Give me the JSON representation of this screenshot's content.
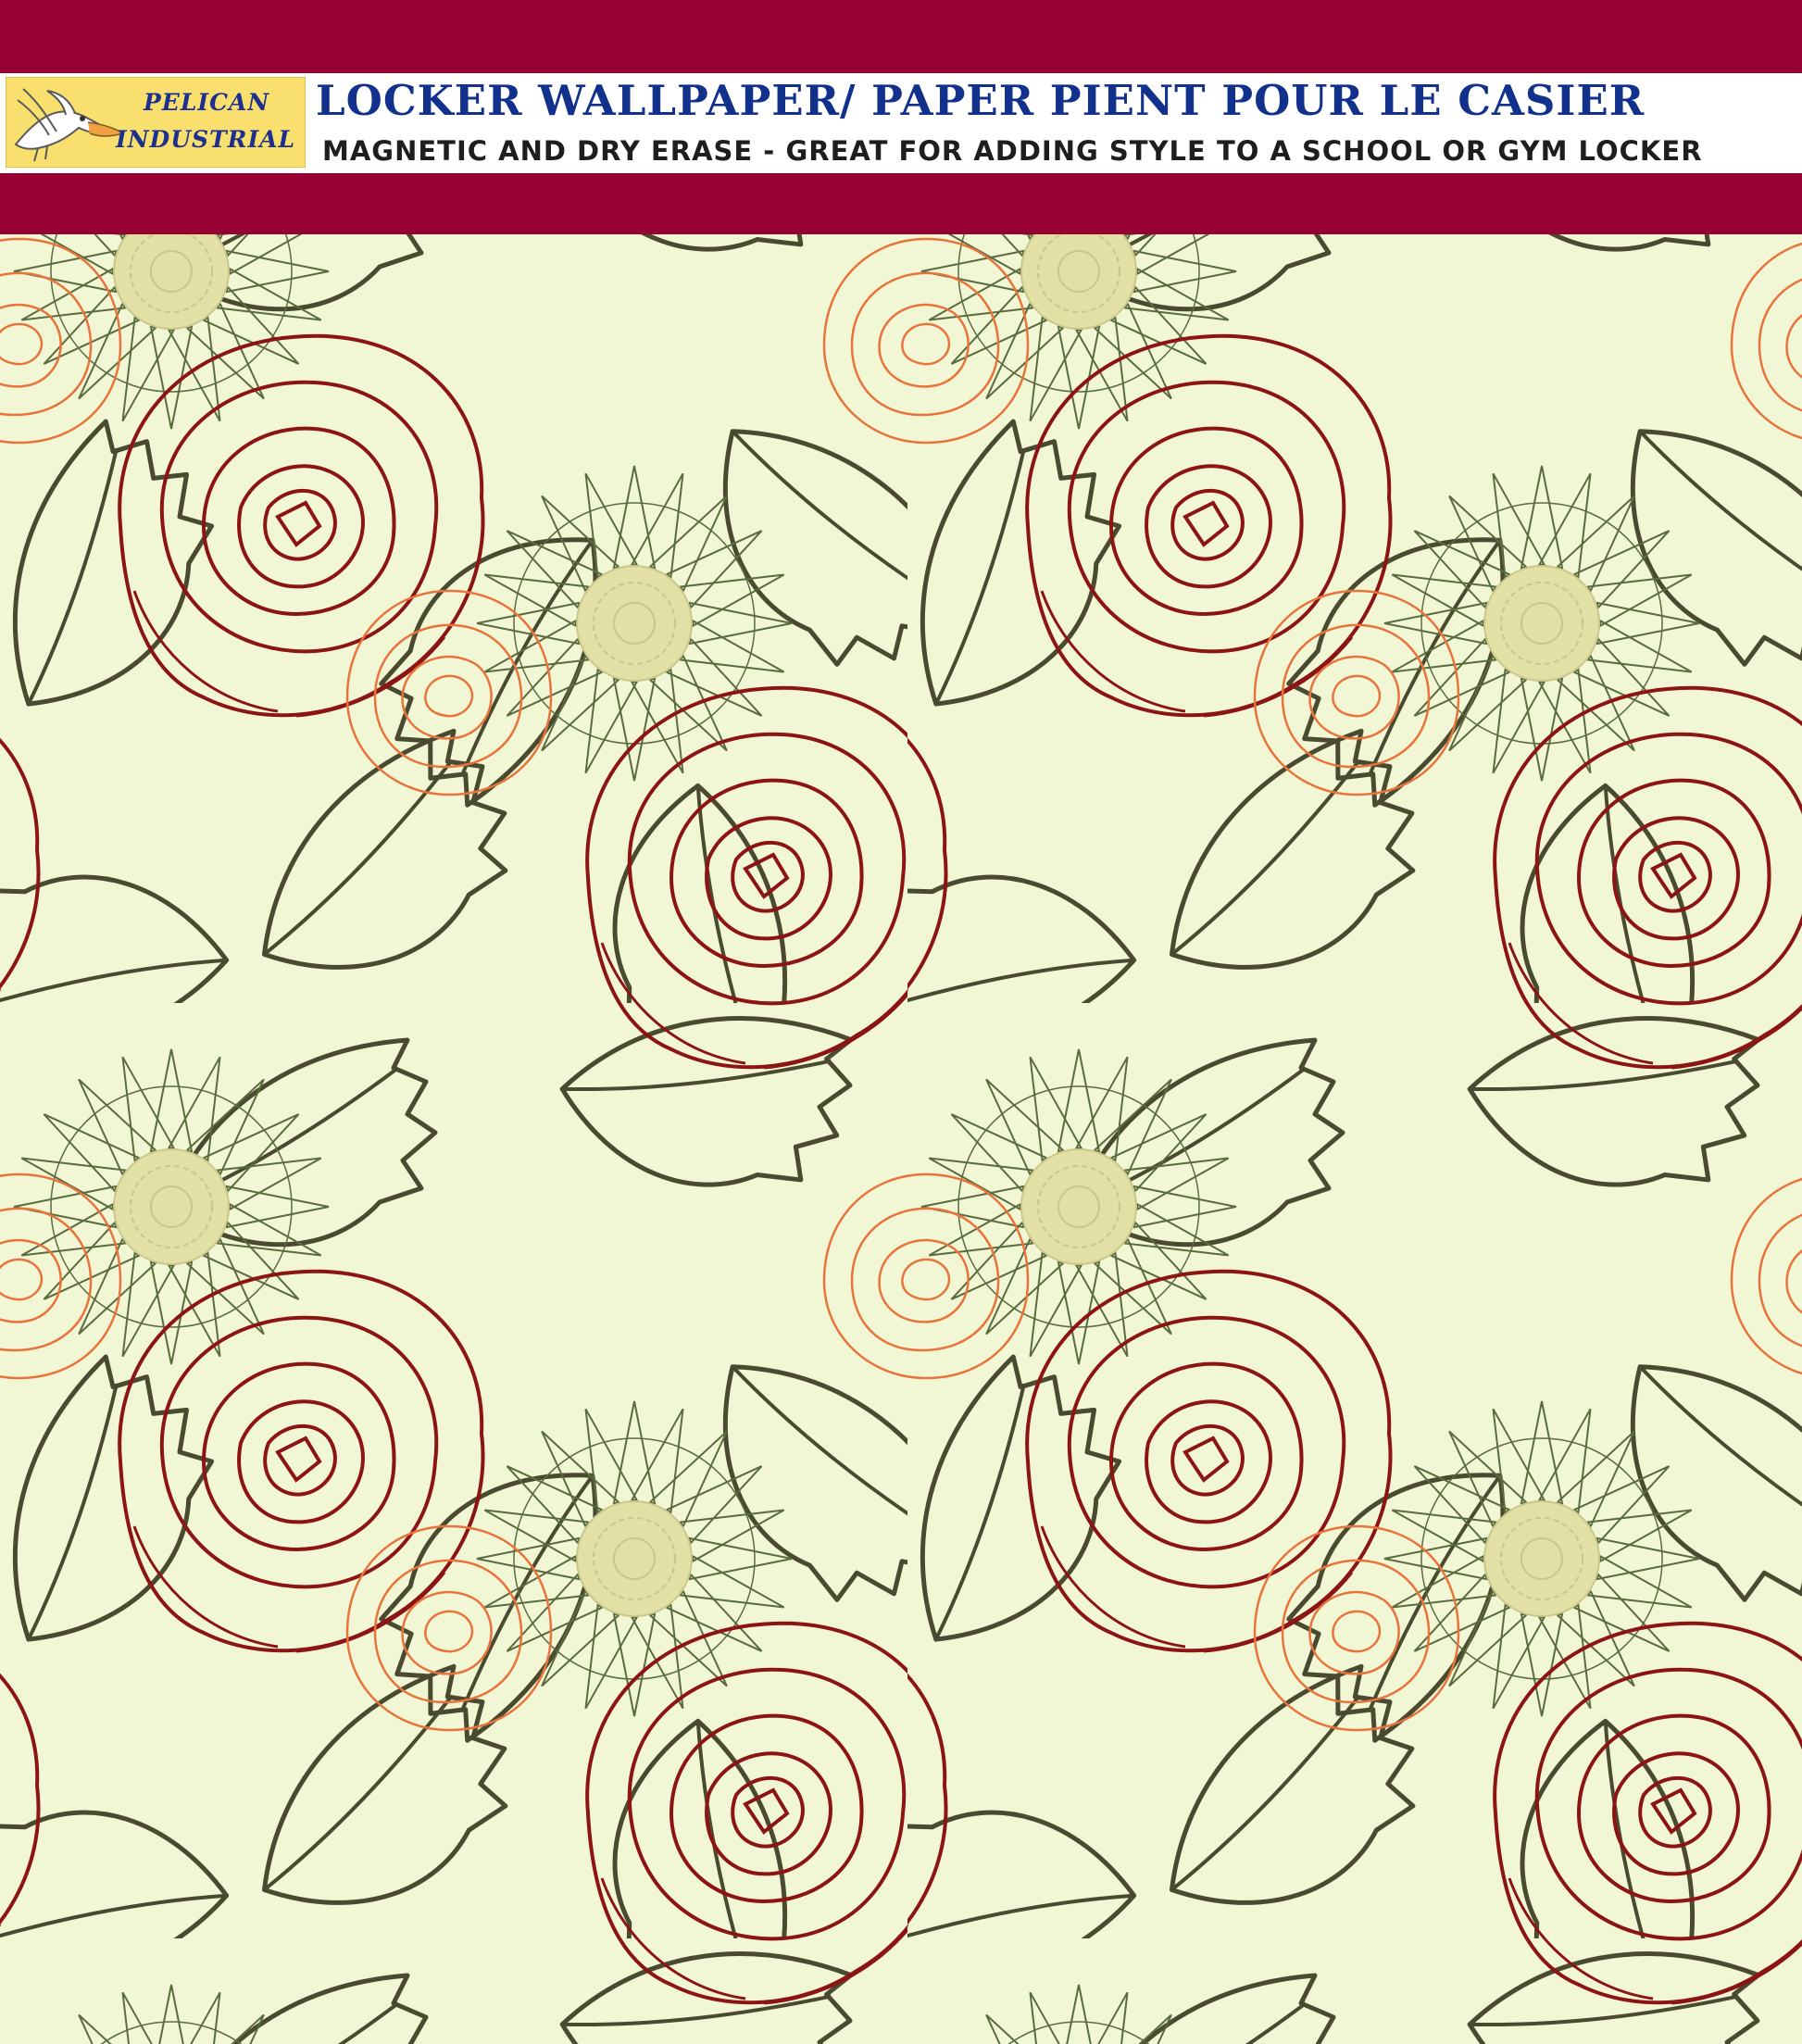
{
  "logo": {
    "line1": "PELICAN",
    "line2": "INDUSTRIAL",
    "icon": "pelican-icon"
  },
  "header": {
    "title": "LOCKER WALLPAPER/ PAPER PIENT POUR LE CASIER",
    "subtitle": "MAGNETIC AND DRY ERASE - GREAT FOR ADDING STYLE TO A SCHOOL OR GYM LOCKER"
  },
  "colors": {
    "band": "#960032",
    "background": "#f1f7d5",
    "rose_dark": "#8c1414",
    "rose_orange": "#e8743c",
    "leaf_outline": "#4a4a30",
    "daisy_outline": "#5a6b3e",
    "daisy_center": "#e2e0a4"
  }
}
